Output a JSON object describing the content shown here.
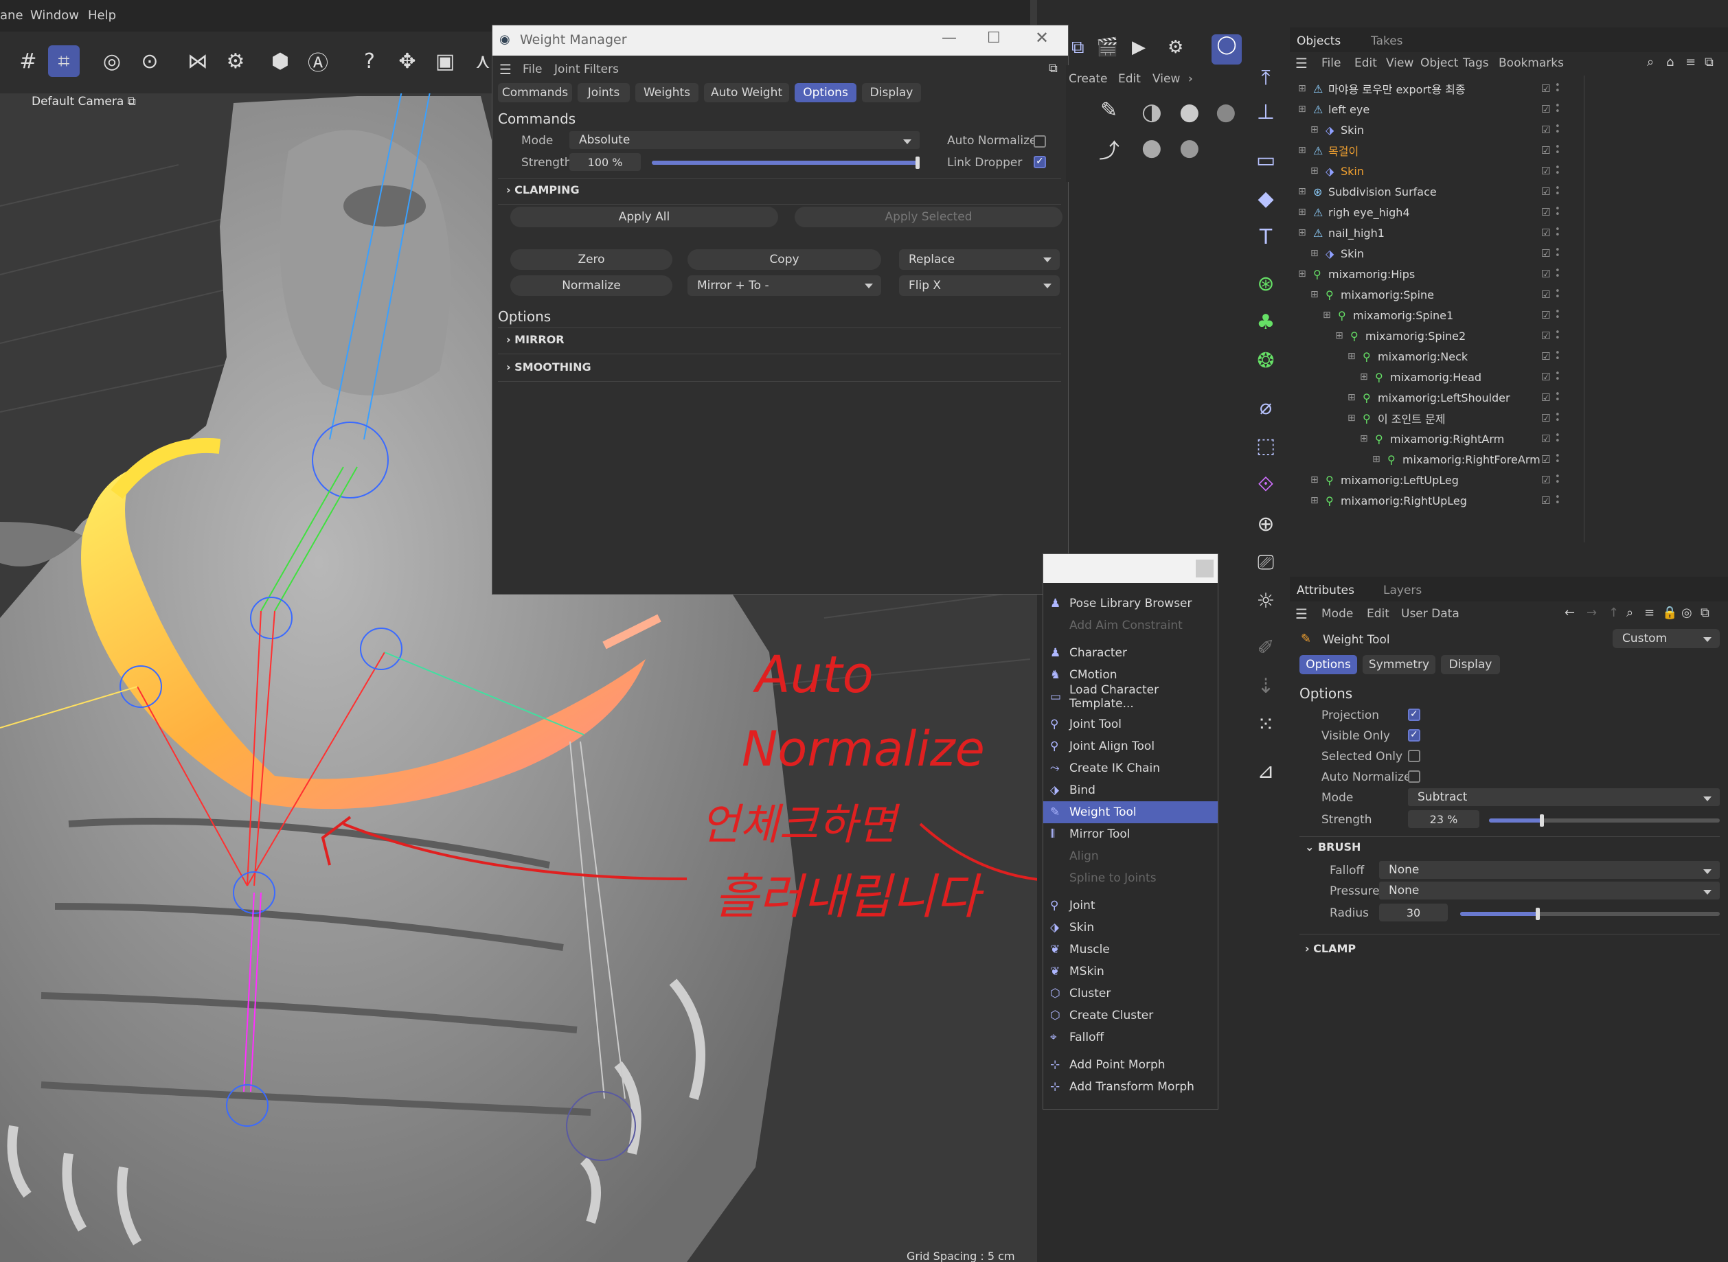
{
  "menubar": {
    "items": [
      "ane",
      "Window",
      "Help"
    ]
  },
  "viewport": {
    "camera_label": "Default Camera",
    "grid_spacing": "Grid Spacing : 5 cm"
  },
  "weight_manager": {
    "title": "Weight Manager",
    "menu": [
      "File",
      "Joint Filters"
    ],
    "tabs": [
      "Commands",
      "Joints",
      "Weights",
      "Auto Weight",
      "Options",
      "Display"
    ],
    "active_tab": "Options",
    "commands_heading": "Commands",
    "mode_label": "Mode",
    "mode_value": "Absolute",
    "strength_label": "Strength",
    "strength_value": "100 %",
    "strength_fraction": 1.0,
    "auto_normalize_label": "Auto Normalize",
    "auto_normalize_checked": false,
    "link_dropper_label": "Link Dropper",
    "link_dropper_checked": true,
    "clamping_label": "CLAMPING",
    "apply_all": "Apply All",
    "apply_selected": "Apply Selected",
    "zero": "Zero",
    "copy": "Copy",
    "replace": "Replace",
    "normalize": "Normalize",
    "mirror_to": "Mirror + To -",
    "flip_x": "Flip X",
    "options_heading": "Options",
    "mirror_label": "MIRROR",
    "smoothing_label": "SMOOTHING"
  },
  "cm_panel": {
    "menu": [
      "Create",
      "Edit",
      "View"
    ]
  },
  "popup_menu": {
    "items": [
      {
        "label": "Pose Library Browser",
        "disabled": false,
        "icon": "pose-icon"
      },
      {
        "label": "Add Aim Constraint",
        "disabled": true,
        "icon": ""
      },
      {
        "label": "Character",
        "disabled": false,
        "icon": "character-icon"
      },
      {
        "label": "CMotion",
        "disabled": false,
        "icon": "cmotion-icon"
      },
      {
        "label": "Load Character Template...",
        "disabled": false,
        "icon": "folder-icon"
      },
      {
        "label": "Joint Tool",
        "disabled": false,
        "icon": "joint-tool-icon"
      },
      {
        "label": "Joint Align Tool",
        "disabled": false,
        "icon": "joint-align-icon"
      },
      {
        "label": "Create IK Chain",
        "disabled": false,
        "icon": "ik-chain-icon"
      },
      {
        "label": "Bind",
        "disabled": false,
        "icon": "bind-icon"
      },
      {
        "label": "Weight Tool",
        "disabled": false,
        "icon": "weight-tool-icon"
      },
      {
        "label": "Mirror Tool",
        "disabled": false,
        "icon": "mirror-tool-icon"
      },
      {
        "label": "Align",
        "disabled": true,
        "icon": ""
      },
      {
        "label": "Spline to Joints",
        "disabled": true,
        "icon": ""
      },
      {
        "label": "Joint",
        "disabled": false,
        "icon": "joint-icon"
      },
      {
        "label": "Skin",
        "disabled": false,
        "icon": "skin-icon"
      },
      {
        "label": "Muscle",
        "disabled": false,
        "icon": "muscle-icon"
      },
      {
        "label": "MSkin",
        "disabled": false,
        "icon": "mskin-icon"
      },
      {
        "label": "Cluster",
        "disabled": false,
        "icon": "cluster-icon"
      },
      {
        "label": "Create Cluster",
        "disabled": false,
        "icon": "create-cluster-icon"
      },
      {
        "label": "Falloff",
        "disabled": false,
        "icon": "falloff-icon"
      },
      {
        "label": "Add Point Morph",
        "disabled": false,
        "icon": "point-morph-icon"
      },
      {
        "label": "Add Transform Morph",
        "disabled": false,
        "icon": "transform-morph-icon"
      }
    ],
    "selected": "Weight Tool"
  },
  "objects_panel": {
    "tabs": [
      "Objects",
      "Takes"
    ],
    "menu": [
      "File",
      "Edit",
      "View",
      "Object",
      "Tags",
      "Bookmarks"
    ],
    "rows": [
      {
        "label": "마야용 로우만 export용 최종",
        "indent": 0,
        "icon": "mesh-icon",
        "color": "#d8d8d8"
      },
      {
        "label": "left eye",
        "indent": 0,
        "icon": "mesh-icon",
        "color": "#d8d8d8"
      },
      {
        "label": "Skin",
        "indent": 1,
        "icon": "skin-icon",
        "color": "#d8d8d8"
      },
      {
        "label": "목걸이",
        "indent": 0,
        "icon": "mesh-icon",
        "color": "#f0a030"
      },
      {
        "label": "Skin",
        "indent": 1,
        "icon": "skin-icon",
        "color": "#f0a030"
      },
      {
        "label": "Subdivision Surface",
        "indent": 0,
        "icon": "subdivision-icon",
        "color": "#d8d8d8"
      },
      {
        "label": "righ eye_high4",
        "indent": 0,
        "icon": "mesh-icon",
        "color": "#d8d8d8"
      },
      {
        "label": "nail_high1",
        "indent": 0,
        "icon": "mesh-icon",
        "color": "#d8d8d8"
      },
      {
        "label": "Skin",
        "indent": 1,
        "icon": "skin-icon",
        "color": "#d8d8d8"
      },
      {
        "label": "mixamorig:Hips",
        "indent": 0,
        "icon": "joint-icon",
        "color": "#d8d8d8"
      },
      {
        "label": "mixamorig:Spine",
        "indent": 1,
        "icon": "joint-icon",
        "color": "#d8d8d8"
      },
      {
        "label": "mixamorig:Spine1",
        "indent": 2,
        "icon": "joint-icon",
        "color": "#d8d8d8"
      },
      {
        "label": "mixamorig:Spine2",
        "indent": 3,
        "icon": "joint-icon",
        "color": "#d8d8d8"
      },
      {
        "label": "mixamorig:Neck",
        "indent": 4,
        "icon": "joint-icon",
        "color": "#d8d8d8"
      },
      {
        "label": "mixamorig:Head",
        "indent": 5,
        "icon": "joint-icon",
        "color": "#d8d8d8"
      },
      {
        "label": "mixamorig:LeftShoulder",
        "indent": 4,
        "icon": "joint-icon",
        "color": "#d8d8d8"
      },
      {
        "label": "이 조인트 문제",
        "indent": 4,
        "icon": "joint-icon",
        "color": "#d8d8d8"
      },
      {
        "label": "mixamorig:RightArm",
        "indent": 5,
        "icon": "joint-icon",
        "color": "#d8d8d8"
      },
      {
        "label": "mixamorig:RightForeArm",
        "indent": 6,
        "icon": "joint-icon",
        "color": "#d8d8d8"
      },
      {
        "label": "mixamorig:LeftUpLeg",
        "indent": 1,
        "icon": "joint-icon",
        "color": "#d8d8d8"
      },
      {
        "label": "mixamorig:RightUpLeg",
        "indent": 1,
        "icon": "joint-icon",
        "color": "#d8d8d8"
      }
    ]
  },
  "attributes_panel": {
    "tabs": [
      "Attributes",
      "Layers"
    ],
    "menu": [
      "Mode",
      "Edit",
      "User Data"
    ],
    "tool_name": "Weight Tool",
    "preset": "Custom",
    "subtabs": [
      "Options",
      "Symmetry",
      "Display"
    ],
    "options_heading": "Options",
    "projection": "Projection",
    "visible_only": "Visible Only",
    "selected_only": "Selected Only",
    "auto_normalize": "Auto Normalize",
    "mode_label": "Mode",
    "mode_value": "Subtract",
    "strength_label": "Strength",
    "strength_value": "23 %",
    "strength_fraction": 0.23,
    "brush_label": "BRUSH",
    "falloff_label": "Falloff",
    "falloff_value": "None",
    "pressure_label": "Pressure",
    "pressure_value": "None",
    "radius_label": "Radius",
    "radius_value": "30",
    "radius_fraction": 0.3,
    "clamp_label": "CLAMP"
  },
  "annotation": {
    "line1": "Auto",
    "line2": "Normalize",
    "line3": "언체크하면",
    "line4": "흘러내립니다"
  }
}
